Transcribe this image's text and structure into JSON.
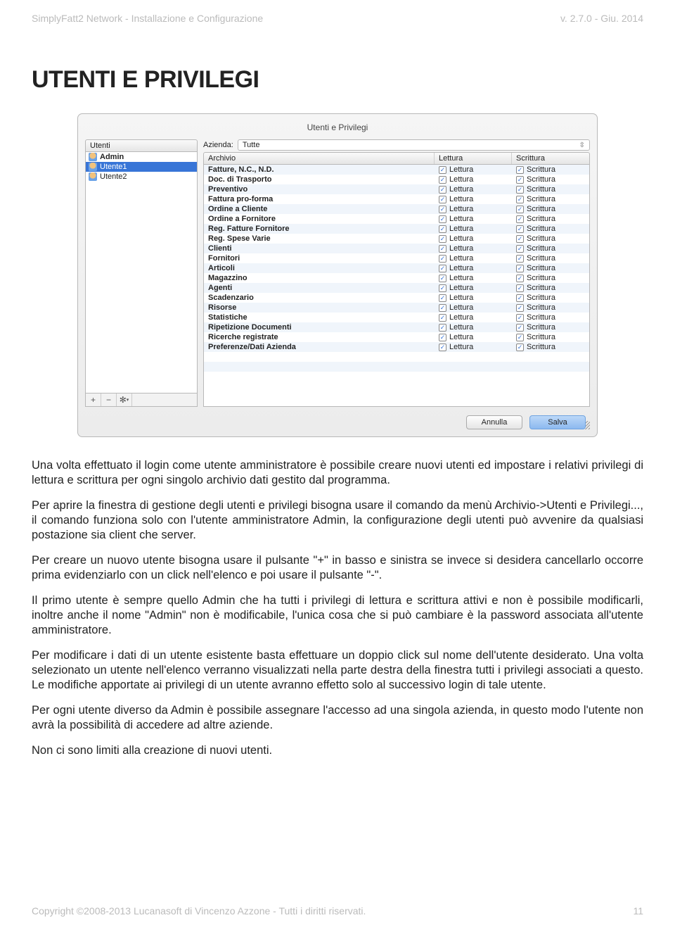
{
  "header": {
    "left": "SimplyFatt2 Network - Installazione e Configurazione",
    "right": "v. 2.7.0 - Giu. 2014"
  },
  "title": "UTENTI E PRIVILEGI",
  "window": {
    "title": "Utenti e Privilegi",
    "users_header": "Utenti",
    "users": [
      {
        "name": "Admin",
        "bold": true,
        "selected": false
      },
      {
        "name": "Utente1",
        "bold": false,
        "selected": true
      },
      {
        "name": "Utente2",
        "bold": false,
        "selected": false
      }
    ],
    "tool_add": "+",
    "tool_remove": "−",
    "tool_gear": "✻",
    "azienda_label": "Azienda:",
    "azienda_value": "Tutte",
    "cols": {
      "a": "Archivio",
      "b": "Lettura",
      "c": "Scrittura"
    },
    "rows": [
      {
        "a": "Fatture, N.C., N.D.",
        "b": "Lettura",
        "c": "Scrittura"
      },
      {
        "a": "Doc. di Trasporto",
        "b": "Lettura",
        "c": "Scrittura"
      },
      {
        "a": "Preventivo",
        "b": "Lettura",
        "c": "Scrittura"
      },
      {
        "a": "Fattura pro-forma",
        "b": "Lettura",
        "c": "Scrittura"
      },
      {
        "a": "Ordine a Cliente",
        "b": "Lettura",
        "c": "Scrittura"
      },
      {
        "a": "Ordine a Fornitore",
        "b": "Lettura",
        "c": "Scrittura"
      },
      {
        "a": "Reg. Fatture Fornitore",
        "b": "Lettura",
        "c": "Scrittura"
      },
      {
        "a": "Reg. Spese Varie",
        "b": "Lettura",
        "c": "Scrittura"
      },
      {
        "a": "Clienti",
        "b": "Lettura",
        "c": "Scrittura"
      },
      {
        "a": "Fornitori",
        "b": "Lettura",
        "c": "Scrittura"
      },
      {
        "a": "Articoli",
        "b": "Lettura",
        "c": "Scrittura"
      },
      {
        "a": "Magazzino",
        "b": "Lettura",
        "c": "Scrittura"
      },
      {
        "a": "Agenti",
        "b": "Lettura",
        "c": "Scrittura"
      },
      {
        "a": "Scadenzario",
        "b": "Lettura",
        "c": "Scrittura"
      },
      {
        "a": "Risorse",
        "b": "Lettura",
        "c": "Scrittura"
      },
      {
        "a": "Statistiche",
        "b": "Lettura",
        "c": "Scrittura"
      },
      {
        "a": "Ripetizione Documenti",
        "b": "Lettura",
        "c": "Scrittura"
      },
      {
        "a": "Ricerche registrate",
        "b": "Lettura",
        "c": "Scrittura"
      },
      {
        "a": "Preferenze/Dati Azienda",
        "b": "Lettura",
        "c": "Scrittura"
      }
    ],
    "extra_rows": 3,
    "cancel": "Annulla",
    "save": "Salva"
  },
  "paragraphs": [
    "Una volta effettuato il login come utente amministratore è possibile creare nuovi utenti ed impostare i relativi privilegi di lettura e scrittura per ogni singolo archivio dati gestito dal programma.",
    "Per aprire la finestra di gestione degli utenti e privilegi bisogna usare il comando da menù Archivio->Utenti e Privilegi..., il comando funziona solo con l'utente amministratore Admin, la configurazione degli utenti può avvenire da qualsiasi postazione sia client che server.",
    "Per creare un nuovo utente bisogna usare il pulsante \"+\" in basso e sinistra se invece si desidera cancellarlo occorre prima evidenziarlo con un click nell'elenco e poi usare il pulsante \"-\".",
    "Il primo utente è sempre quello Admin che ha tutti i privilegi di lettura e scrittura attivi e non è possibile modificarli, inoltre anche il nome \"Admin\" non è modificabile, l'unica cosa che si può cambiare è la password associata all'utente amministratore.",
    "Per modificare i dati di un utente esistente basta effettuare un doppio click sul nome dell'utente desiderato. Una volta selezionato un utente nell'elenco verranno visualizzati nella parte destra della finestra tutti i privilegi associati a questo. Le modifiche apportate ai privilegi di un utente avranno effetto solo al successivo login di tale utente.",
    "Per ogni utente diverso da Admin è possibile assegnare l'accesso ad una singola azienda, in questo modo l'utente non avrà la possibilità di accedere ad altre aziende.",
    "Non ci sono limiti alla creazione di nuovi utenti."
  ],
  "footer": {
    "left": "Copyright ©2008-2013 Lucanasoft di Vincenzo Azzone - Tutti i diritti riservati.",
    "right": "11"
  }
}
